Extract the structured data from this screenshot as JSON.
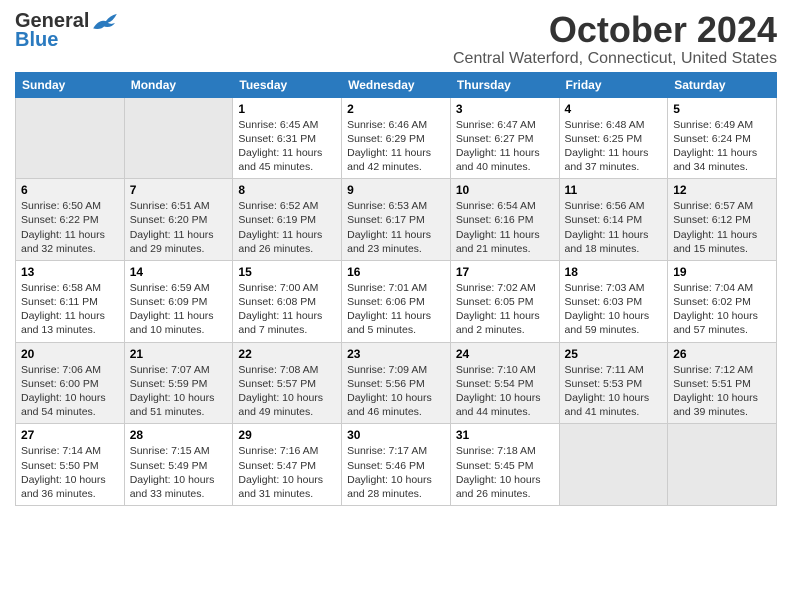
{
  "header": {
    "logo_general": "General",
    "logo_blue": "Blue",
    "month_title": "October 2024",
    "location": "Central Waterford, Connecticut, United States"
  },
  "weekdays": [
    "Sunday",
    "Monday",
    "Tuesday",
    "Wednesday",
    "Thursday",
    "Friday",
    "Saturday"
  ],
  "weeks": [
    {
      "days": [
        {
          "num": "",
          "info": ""
        },
        {
          "num": "",
          "info": ""
        },
        {
          "num": "1",
          "info": "Sunrise: 6:45 AM\nSunset: 6:31 PM\nDaylight: 11 hours and 45 minutes."
        },
        {
          "num": "2",
          "info": "Sunrise: 6:46 AM\nSunset: 6:29 PM\nDaylight: 11 hours and 42 minutes."
        },
        {
          "num": "3",
          "info": "Sunrise: 6:47 AM\nSunset: 6:27 PM\nDaylight: 11 hours and 40 minutes."
        },
        {
          "num": "4",
          "info": "Sunrise: 6:48 AM\nSunset: 6:25 PM\nDaylight: 11 hours and 37 minutes."
        },
        {
          "num": "5",
          "info": "Sunrise: 6:49 AM\nSunset: 6:24 PM\nDaylight: 11 hours and 34 minutes."
        }
      ]
    },
    {
      "days": [
        {
          "num": "6",
          "info": "Sunrise: 6:50 AM\nSunset: 6:22 PM\nDaylight: 11 hours and 32 minutes."
        },
        {
          "num": "7",
          "info": "Sunrise: 6:51 AM\nSunset: 6:20 PM\nDaylight: 11 hours and 29 minutes."
        },
        {
          "num": "8",
          "info": "Sunrise: 6:52 AM\nSunset: 6:19 PM\nDaylight: 11 hours and 26 minutes."
        },
        {
          "num": "9",
          "info": "Sunrise: 6:53 AM\nSunset: 6:17 PM\nDaylight: 11 hours and 23 minutes."
        },
        {
          "num": "10",
          "info": "Sunrise: 6:54 AM\nSunset: 6:16 PM\nDaylight: 11 hours and 21 minutes."
        },
        {
          "num": "11",
          "info": "Sunrise: 6:56 AM\nSunset: 6:14 PM\nDaylight: 11 hours and 18 minutes."
        },
        {
          "num": "12",
          "info": "Sunrise: 6:57 AM\nSunset: 6:12 PM\nDaylight: 11 hours and 15 minutes."
        }
      ]
    },
    {
      "days": [
        {
          "num": "13",
          "info": "Sunrise: 6:58 AM\nSunset: 6:11 PM\nDaylight: 11 hours and 13 minutes."
        },
        {
          "num": "14",
          "info": "Sunrise: 6:59 AM\nSunset: 6:09 PM\nDaylight: 11 hours and 10 minutes."
        },
        {
          "num": "15",
          "info": "Sunrise: 7:00 AM\nSunset: 6:08 PM\nDaylight: 11 hours and 7 minutes."
        },
        {
          "num": "16",
          "info": "Sunrise: 7:01 AM\nSunset: 6:06 PM\nDaylight: 11 hours and 5 minutes."
        },
        {
          "num": "17",
          "info": "Sunrise: 7:02 AM\nSunset: 6:05 PM\nDaylight: 11 hours and 2 minutes."
        },
        {
          "num": "18",
          "info": "Sunrise: 7:03 AM\nSunset: 6:03 PM\nDaylight: 10 hours and 59 minutes."
        },
        {
          "num": "19",
          "info": "Sunrise: 7:04 AM\nSunset: 6:02 PM\nDaylight: 10 hours and 57 minutes."
        }
      ]
    },
    {
      "days": [
        {
          "num": "20",
          "info": "Sunrise: 7:06 AM\nSunset: 6:00 PM\nDaylight: 10 hours and 54 minutes."
        },
        {
          "num": "21",
          "info": "Sunrise: 7:07 AM\nSunset: 5:59 PM\nDaylight: 10 hours and 51 minutes."
        },
        {
          "num": "22",
          "info": "Sunrise: 7:08 AM\nSunset: 5:57 PM\nDaylight: 10 hours and 49 minutes."
        },
        {
          "num": "23",
          "info": "Sunrise: 7:09 AM\nSunset: 5:56 PM\nDaylight: 10 hours and 46 minutes."
        },
        {
          "num": "24",
          "info": "Sunrise: 7:10 AM\nSunset: 5:54 PM\nDaylight: 10 hours and 44 minutes."
        },
        {
          "num": "25",
          "info": "Sunrise: 7:11 AM\nSunset: 5:53 PM\nDaylight: 10 hours and 41 minutes."
        },
        {
          "num": "26",
          "info": "Sunrise: 7:12 AM\nSunset: 5:51 PM\nDaylight: 10 hours and 39 minutes."
        }
      ]
    },
    {
      "days": [
        {
          "num": "27",
          "info": "Sunrise: 7:14 AM\nSunset: 5:50 PM\nDaylight: 10 hours and 36 minutes."
        },
        {
          "num": "28",
          "info": "Sunrise: 7:15 AM\nSunset: 5:49 PM\nDaylight: 10 hours and 33 minutes."
        },
        {
          "num": "29",
          "info": "Sunrise: 7:16 AM\nSunset: 5:47 PM\nDaylight: 10 hours and 31 minutes."
        },
        {
          "num": "30",
          "info": "Sunrise: 7:17 AM\nSunset: 5:46 PM\nDaylight: 10 hours and 28 minutes."
        },
        {
          "num": "31",
          "info": "Sunrise: 7:18 AM\nSunset: 5:45 PM\nDaylight: 10 hours and 26 minutes."
        },
        {
          "num": "",
          "info": ""
        },
        {
          "num": "",
          "info": ""
        }
      ]
    }
  ]
}
